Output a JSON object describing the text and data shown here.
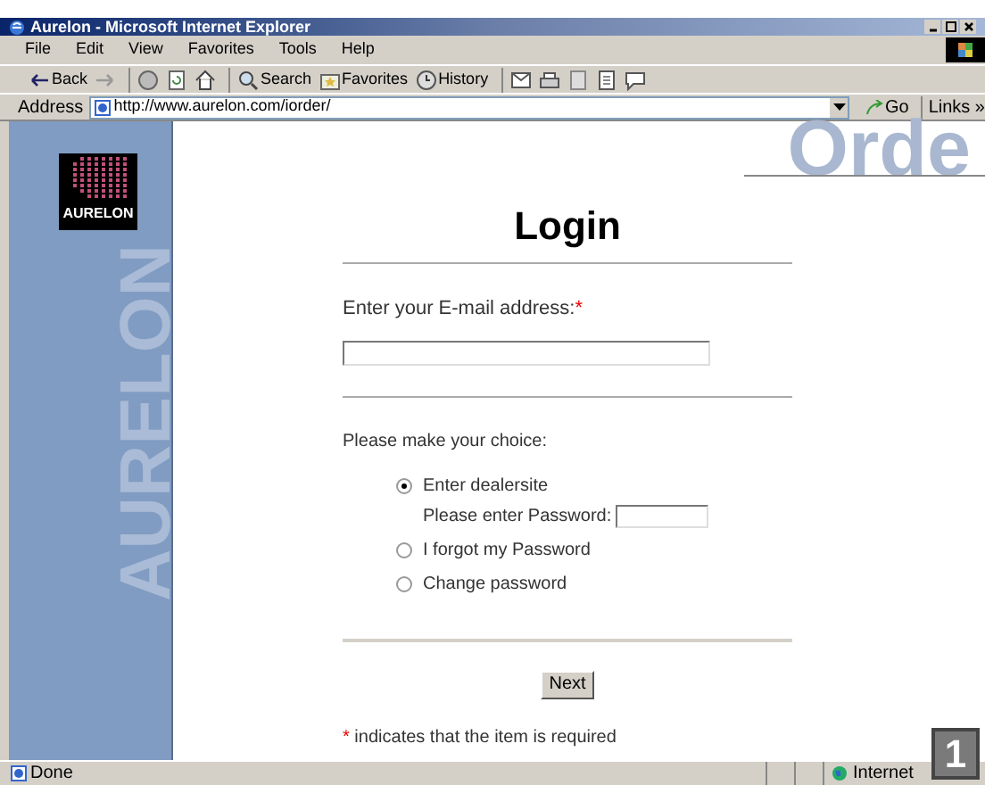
{
  "window": {
    "title": "Aurelon - Microsoft Internet Explorer"
  },
  "menu": [
    "File",
    "Edit",
    "View",
    "Favorites",
    "Tools",
    "Help"
  ],
  "toolbar": [
    {
      "kind": "back",
      "label": "Back"
    },
    {
      "kind": "forward"
    },
    {
      "kind": "stop"
    },
    {
      "kind": "refresh"
    },
    {
      "kind": "home"
    },
    {
      "kind": "search",
      "label": "Search"
    },
    {
      "kind": "favorites",
      "label": "Favorites"
    },
    {
      "kind": "history",
      "label": "History"
    },
    {
      "kind": "mail"
    },
    {
      "kind": "print"
    },
    {
      "kind": "edit"
    },
    {
      "kind": "discuss"
    },
    {
      "kind": "messenger"
    }
  ],
  "address_bar": {
    "label": "Address",
    "url": "http://www.aurelon.com/iorder/",
    "go": "Go",
    "links": "Links »"
  },
  "sidebar": {
    "logo_text": "AURELON",
    "vertical_text": "AURELON"
  },
  "page": {
    "banner": "Orde",
    "heading": "Login",
    "email_label": "Enter your E-mail address:",
    "required_mark": "*",
    "choice_label": "Please make your choice:",
    "options": [
      {
        "label": "Enter dealersite",
        "selected": true,
        "password_label": "Please enter Password:"
      },
      {
        "label": "I forgot my Password",
        "selected": false
      },
      {
        "label": "Change password",
        "selected": false
      }
    ],
    "next_button": "Next",
    "note_mark": "*",
    "note": "indicates that the item is required"
  },
  "status_bar": {
    "text": "Done",
    "zone": "Internet"
  },
  "marker": "1"
}
